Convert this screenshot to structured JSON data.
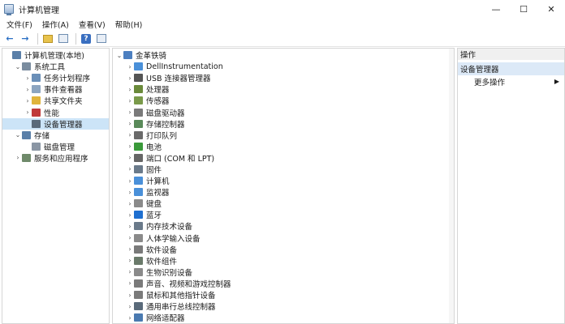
{
  "window": {
    "title": "计算机管理",
    "minimize": "—",
    "maximize": "☐",
    "close": "✕"
  },
  "menu": [
    "文件(F)",
    "操作(A)",
    "查看(V)",
    "帮助(H)"
  ],
  "left_tree": [
    {
      "label": "计算机管理(本地)",
      "indent": 0,
      "chev": "",
      "icon": "computer-icon",
      "color": "#5a7fa8"
    },
    {
      "label": "系统工具",
      "indent": 1,
      "chev": "⌄",
      "icon": "tools-icon",
      "color": "#7a8c9f"
    },
    {
      "label": "任务计划程序",
      "indent": 2,
      "chev": "›",
      "icon": "clock-icon",
      "color": "#6a8fb8"
    },
    {
      "label": "事件查看器",
      "indent": 2,
      "chev": "›",
      "icon": "event-viewer-icon",
      "color": "#8ca5c0"
    },
    {
      "label": "共享文件夹",
      "indent": 2,
      "chev": "›",
      "icon": "shared-folder-icon",
      "color": "#e0b43c"
    },
    {
      "label": "性能",
      "indent": 2,
      "chev": "›",
      "icon": "performance-icon",
      "color": "#c03a3a"
    },
    {
      "label": "设备管理器",
      "indent": 2,
      "chev": "",
      "icon": "device-manager-icon",
      "color": "#5a6a7a",
      "selected": true
    },
    {
      "label": "存储",
      "indent": 1,
      "chev": "⌄",
      "icon": "storage-icon",
      "color": "#5a7fa8"
    },
    {
      "label": "磁盘管理",
      "indent": 2,
      "chev": "",
      "icon": "disk-icon",
      "color": "#8a96a4"
    },
    {
      "label": "服务和应用程序",
      "indent": 1,
      "chev": "›",
      "icon": "services-icon",
      "color": "#6f8a6a"
    }
  ],
  "device_root": {
    "label": "金革铁骑",
    "icon": "computer-icon",
    "color": "#4c7fc0"
  },
  "devices": [
    {
      "label": "DellInstrumentation",
      "icon": "monitor-icon",
      "color": "#4a90d9"
    },
    {
      "label": "USB 连接器管理器",
      "icon": "usb-icon",
      "color": "#555555"
    },
    {
      "label": "处理器",
      "icon": "processor-icon",
      "color": "#6a8a3a"
    },
    {
      "label": "传感器",
      "icon": "sensor-icon",
      "color": "#7a9a4a"
    },
    {
      "label": "磁盘驱动器",
      "icon": "disk-drive-icon",
      "color": "#7a7a7a"
    },
    {
      "label": "存储控制器",
      "icon": "storage-controller-icon",
      "color": "#5a8a5a"
    },
    {
      "label": "打印队列",
      "icon": "printer-icon",
      "color": "#6a6a6a"
    },
    {
      "label": "电池",
      "icon": "battery-icon",
      "color": "#3a9a3a"
    },
    {
      "label": "端口 (COM 和 LPT)",
      "icon": "port-icon",
      "color": "#666666"
    },
    {
      "label": "固件",
      "icon": "firmware-icon",
      "color": "#6a7a8a"
    },
    {
      "label": "计算机",
      "icon": "computer-icon",
      "color": "#4a90d9"
    },
    {
      "label": "监视器",
      "icon": "monitor-icon",
      "color": "#4a90d9"
    },
    {
      "label": "键盘",
      "icon": "keyboard-icon",
      "color": "#8a8a8a"
    },
    {
      "label": "蓝牙",
      "icon": "bluetooth-icon",
      "color": "#1e6fd0"
    },
    {
      "label": "内存技术设备",
      "icon": "memory-icon",
      "color": "#6a7a8a"
    },
    {
      "label": "人体学输入设备",
      "icon": "hid-icon",
      "color": "#8a8a8a"
    },
    {
      "label": "软件设备",
      "icon": "software-device-icon",
      "color": "#7a7a7a"
    },
    {
      "label": "软件组件",
      "icon": "software-component-icon",
      "color": "#6a7a6a"
    },
    {
      "label": "生物识别设备",
      "icon": "biometric-icon",
      "color": "#8a8a8a"
    },
    {
      "label": "声音、视频和游戏控制器",
      "icon": "speaker-icon",
      "color": "#7a7a7a"
    },
    {
      "label": "鼠标和其他指针设备",
      "icon": "mouse-icon",
      "color": "#7a7a7a"
    },
    {
      "label": "通用串行总线控制器",
      "icon": "usb-controller-icon",
      "color": "#5a6a7a"
    },
    {
      "label": "网络适配器",
      "icon": "network-icon",
      "color": "#4a7ab0"
    }
  ],
  "actions": {
    "header": "操作",
    "title": "设备管理器",
    "more": "更多操作",
    "more_arrow": "▶"
  }
}
